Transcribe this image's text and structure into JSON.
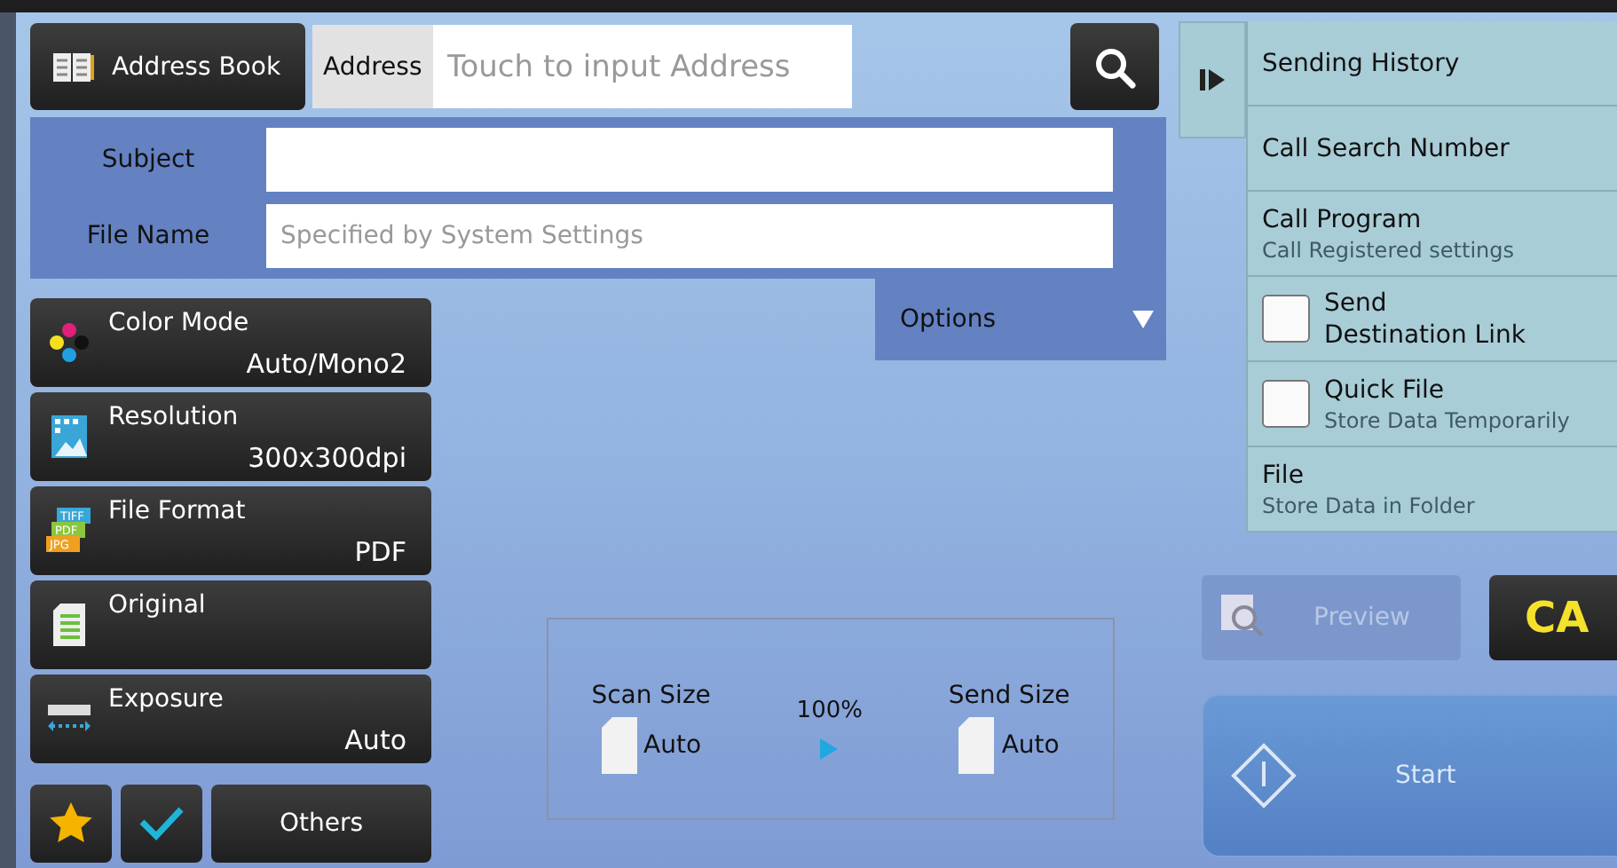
{
  "address_book_button": "Address Book",
  "address": {
    "label": "Address",
    "placeholder": "Touch to input Address"
  },
  "form": {
    "fields": [
      {
        "label": "Subject"
      },
      {
        "label": "File Name",
        "placeholder": "Specified by System Settings"
      }
    ],
    "options_tab": "Options"
  },
  "settings": [
    {
      "label": "Color Mode",
      "value": "Auto/Mono2"
    },
    {
      "label": "Resolution",
      "value": "300x300dpi"
    },
    {
      "label": "File Format",
      "value": "PDF",
      "icon_labels": [
        "TIFF",
        "PDF",
        "JPG"
      ]
    },
    {
      "label": "Original"
    },
    {
      "label": "Exposure",
      "value": "Auto"
    }
  ],
  "others_button": "Others",
  "size_panel": {
    "scan_label": "Scan Size",
    "scan_value": "Auto",
    "ratio": "100%",
    "send_label": "Send Size",
    "send_value": "Auto"
  },
  "side_menu": [
    {
      "kind": "link",
      "title": [
        "Sending History"
      ]
    },
    {
      "kind": "link",
      "title": [
        "Call Search Number"
      ]
    },
    {
      "kind": "link",
      "title": [
        "Call Program"
      ],
      "subtitle": "Call Registered settings"
    },
    {
      "kind": "checkbox",
      "title": [
        "Send",
        "Destination Link"
      ],
      "checked": false
    },
    {
      "kind": "checkbox",
      "title": [
        "Quick File"
      ],
      "subtitle": "Store Data Temporarily",
      "checked": false
    },
    {
      "kind": "link",
      "title": [
        "File"
      ],
      "subtitle": "Store Data in Folder"
    }
  ],
  "preview_button": {
    "label": "Preview",
    "disabled": true
  },
  "ca_button": "CA",
  "start_button": {
    "label": "Start",
    "disabled": true
  }
}
